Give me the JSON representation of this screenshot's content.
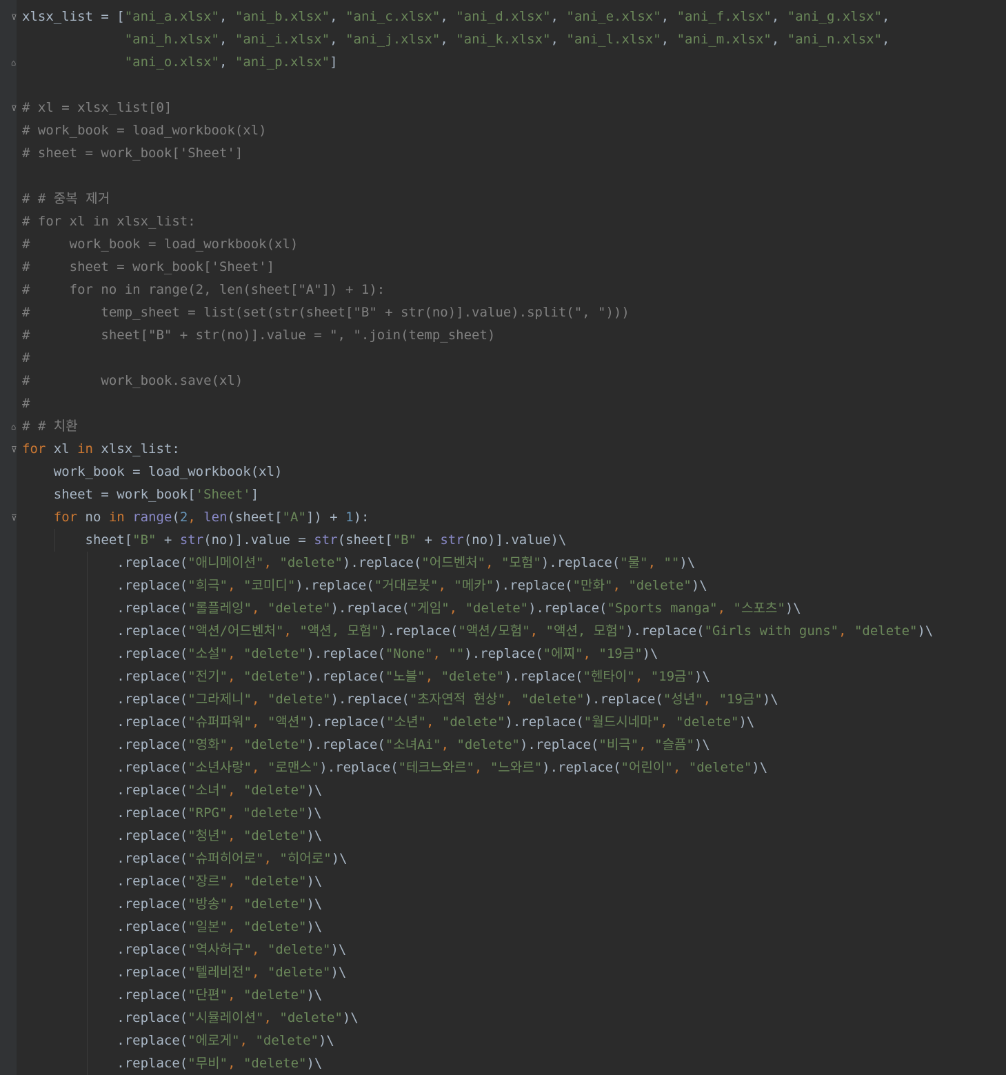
{
  "editor": {
    "theme": "darcula",
    "colors": {
      "background": "#2b2b2b",
      "gutter": "#313335",
      "text": "#a9b7c6",
      "string": "#6a8759",
      "keyword": "#cc7832",
      "number": "#6897bb",
      "builtin": "#8888c6",
      "comment": "#808080"
    },
    "lines": [
      [
        [
          "t",
          "xlsx_list = ["
        ],
        [
          "s",
          "\"ani_a.xlsx\""
        ],
        [
          "t",
          ", "
        ],
        [
          "s",
          "\"ani_b.xlsx\""
        ],
        [
          "t",
          ", "
        ],
        [
          "s",
          "\"ani_c.xlsx\""
        ],
        [
          "t",
          ", "
        ],
        [
          "s",
          "\"ani_d.xlsx\""
        ],
        [
          "t",
          ", "
        ],
        [
          "s",
          "\"ani_e.xlsx\""
        ],
        [
          "t",
          ", "
        ],
        [
          "s",
          "\"ani_f.xlsx\""
        ],
        [
          "t",
          ", "
        ],
        [
          "s",
          "\"ani_g.xlsx\""
        ],
        [
          "t",
          ","
        ]
      ],
      [
        [
          "t",
          "             "
        ],
        [
          "s",
          "\"ani_h.xlsx\""
        ],
        [
          "t",
          ", "
        ],
        [
          "s",
          "\"ani_i.xlsx\""
        ],
        [
          "t",
          ", "
        ],
        [
          "s",
          "\"ani_j.xlsx\""
        ],
        [
          "t",
          ", "
        ],
        [
          "s",
          "\"ani_k.xlsx\""
        ],
        [
          "t",
          ", "
        ],
        [
          "s",
          "\"ani_l.xlsx\""
        ],
        [
          "t",
          ", "
        ],
        [
          "s",
          "\"ani_m.xlsx\""
        ],
        [
          "t",
          ", "
        ],
        [
          "s",
          "\"ani_n.xlsx\""
        ],
        [
          "t",
          ","
        ]
      ],
      [
        [
          "t",
          "             "
        ],
        [
          "s",
          "\"ani_o.xlsx\""
        ],
        [
          "t",
          ", "
        ],
        [
          "s",
          "\"ani_p.xlsx\""
        ],
        [
          "t",
          "]"
        ]
      ],
      [],
      [
        [
          "c",
          "# xl = xlsx_list[0]"
        ]
      ],
      [
        [
          "c",
          "# work_book = load_workbook(xl)"
        ]
      ],
      [
        [
          "c",
          "# sheet = work_book['Sheet']"
        ]
      ],
      [],
      [
        [
          "c",
          "# # 중복 제거"
        ]
      ],
      [
        [
          "c",
          "# for xl in xlsx_list:"
        ]
      ],
      [
        [
          "c",
          "#     work_book = load_workbook(xl)"
        ]
      ],
      [
        [
          "c",
          "#     sheet = work_book['Sheet']"
        ]
      ],
      [
        [
          "c",
          "#     for no in range(2, len(sheet[\"A\"]) + 1):"
        ]
      ],
      [
        [
          "c",
          "#         temp_sheet = list(set(str(sheet[\"B\" + str(no)].value).split(\", \")))"
        ]
      ],
      [
        [
          "c",
          "#         sheet[\"B\" + str(no)].value = \", \".join(temp_sheet)"
        ]
      ],
      [
        [
          "c",
          "#"
        ]
      ],
      [
        [
          "c",
          "#         work_book.save(xl)"
        ]
      ],
      [
        [
          "c",
          "#"
        ]
      ],
      [
        [
          "c",
          "# # 치환"
        ]
      ],
      [
        [
          "k",
          "for"
        ],
        [
          "t",
          " xl "
        ],
        [
          "k",
          "in"
        ],
        [
          "t",
          " xlsx_list:"
        ]
      ],
      [
        [
          "t",
          "    work_book = load_workbook(xl)"
        ]
      ],
      [
        [
          "t",
          "    sheet = work_book["
        ],
        [
          "s",
          "'Sheet'"
        ],
        [
          "t",
          "]"
        ]
      ],
      [
        [
          "t",
          "    "
        ],
        [
          "k",
          "for"
        ],
        [
          "t",
          " no "
        ],
        [
          "k",
          "in"
        ],
        [
          "t",
          " "
        ],
        [
          "b",
          "range"
        ],
        [
          "t",
          "("
        ],
        [
          "n",
          "2"
        ],
        [
          "k",
          ", "
        ],
        [
          "b",
          "len"
        ],
        [
          "t",
          "(sheet["
        ],
        [
          "s",
          "\"A\""
        ],
        [
          "t",
          "]) + "
        ],
        [
          "n",
          "1"
        ],
        [
          "t",
          "):"
        ]
      ],
      [
        [
          "t",
          "        sheet["
        ],
        [
          "s",
          "\"B\""
        ],
        [
          "t",
          " + "
        ],
        [
          "b",
          "str"
        ],
        [
          "t",
          "(no)].value = "
        ],
        [
          "b",
          "str"
        ],
        [
          "t",
          "(sheet["
        ],
        [
          "s",
          "\"B\""
        ],
        [
          "t",
          " + "
        ],
        [
          "b",
          "str"
        ],
        [
          "t",
          "(no)].value)\\"
        ]
      ],
      [
        [
          "t",
          "            .replace("
        ],
        [
          "s",
          "\"애니메이션\""
        ],
        [
          "k",
          ", "
        ],
        [
          "s",
          "\"delete\""
        ],
        [
          "t",
          ").replace("
        ],
        [
          "s",
          "\"어드벤처\""
        ],
        [
          "k",
          ", "
        ],
        [
          "s",
          "\"모험\""
        ],
        [
          "t",
          ").replace("
        ],
        [
          "s",
          "\"물\""
        ],
        [
          "k",
          ", "
        ],
        [
          "s",
          "\"\""
        ],
        [
          "t",
          ")\\"
        ]
      ],
      [
        [
          "t",
          "            .replace("
        ],
        [
          "s",
          "\"희극\""
        ],
        [
          "k",
          ", "
        ],
        [
          "s",
          "\"코미디\""
        ],
        [
          "t",
          ").replace("
        ],
        [
          "s",
          "\"거대로봇\""
        ],
        [
          "k",
          ", "
        ],
        [
          "s",
          "\"메카\""
        ],
        [
          "t",
          ").replace("
        ],
        [
          "s",
          "\"만화\""
        ],
        [
          "k",
          ", "
        ],
        [
          "s",
          "\"delete\""
        ],
        [
          "t",
          ")\\"
        ]
      ],
      [
        [
          "t",
          "            .replace("
        ],
        [
          "s",
          "\"롤플레잉\""
        ],
        [
          "k",
          ", "
        ],
        [
          "s",
          "\"delete\""
        ],
        [
          "t",
          ").replace("
        ],
        [
          "s",
          "\"게임\""
        ],
        [
          "k",
          ", "
        ],
        [
          "s",
          "\"delete\""
        ],
        [
          "t",
          ").replace("
        ],
        [
          "s",
          "\"Sports manga\""
        ],
        [
          "k",
          ", "
        ],
        [
          "s",
          "\"스포츠\""
        ],
        [
          "t",
          ")\\"
        ]
      ],
      [
        [
          "t",
          "            .replace("
        ],
        [
          "s",
          "\"액션/어드벤처\""
        ],
        [
          "k",
          ", "
        ],
        [
          "s",
          "\"액션, 모험\""
        ],
        [
          "t",
          ").replace("
        ],
        [
          "s",
          "\"액션/모험\""
        ],
        [
          "k",
          ", "
        ],
        [
          "s",
          "\"액션, 모험\""
        ],
        [
          "t",
          ").replace("
        ],
        [
          "s",
          "\"Girls with guns\""
        ],
        [
          "k",
          ", "
        ],
        [
          "s",
          "\"delete\""
        ],
        [
          "t",
          ")\\"
        ]
      ],
      [
        [
          "t",
          "            .replace("
        ],
        [
          "s",
          "\"소설\""
        ],
        [
          "k",
          ", "
        ],
        [
          "s",
          "\"delete\""
        ],
        [
          "t",
          ").replace("
        ],
        [
          "s",
          "\"None\""
        ],
        [
          "k",
          ", "
        ],
        [
          "s",
          "\"\""
        ],
        [
          "t",
          ").replace("
        ],
        [
          "s",
          "\"에찌\""
        ],
        [
          "k",
          ", "
        ],
        [
          "s",
          "\"19금\""
        ],
        [
          "t",
          ")\\"
        ]
      ],
      [
        [
          "t",
          "            .replace("
        ],
        [
          "s",
          "\"전기\""
        ],
        [
          "k",
          ", "
        ],
        [
          "s",
          "\"delete\""
        ],
        [
          "t",
          ").replace("
        ],
        [
          "s",
          "\"노블\""
        ],
        [
          "k",
          ", "
        ],
        [
          "s",
          "\"delete\""
        ],
        [
          "t",
          ").replace("
        ],
        [
          "s",
          "\"헨타이\""
        ],
        [
          "k",
          ", "
        ],
        [
          "s",
          "\"19금\""
        ],
        [
          "t",
          ")\\"
        ]
      ],
      [
        [
          "t",
          "            .replace("
        ],
        [
          "s",
          "\"그라제니\""
        ],
        [
          "k",
          ", "
        ],
        [
          "s",
          "\"delete\""
        ],
        [
          "t",
          ").replace("
        ],
        [
          "s",
          "\"초자연적 현상\""
        ],
        [
          "k",
          ", "
        ],
        [
          "s",
          "\"delete\""
        ],
        [
          "t",
          ").replace("
        ],
        [
          "s",
          "\"성년\""
        ],
        [
          "k",
          ", "
        ],
        [
          "s",
          "\"19금\""
        ],
        [
          "t",
          ")\\"
        ]
      ],
      [
        [
          "t",
          "            .replace("
        ],
        [
          "s",
          "\"슈퍼파워\""
        ],
        [
          "k",
          ", "
        ],
        [
          "s",
          "\"액션\""
        ],
        [
          "t",
          ").replace("
        ],
        [
          "s",
          "\"소년\""
        ],
        [
          "k",
          ", "
        ],
        [
          "s",
          "\"delete\""
        ],
        [
          "t",
          ").replace("
        ],
        [
          "s",
          "\"월드시네마\""
        ],
        [
          "k",
          ", "
        ],
        [
          "s",
          "\"delete\""
        ],
        [
          "t",
          ")\\"
        ]
      ],
      [
        [
          "t",
          "            .replace("
        ],
        [
          "s",
          "\"영화\""
        ],
        [
          "k",
          ", "
        ],
        [
          "s",
          "\"delete\""
        ],
        [
          "t",
          ").replace("
        ],
        [
          "s",
          "\"소녀Ai\""
        ],
        [
          "k",
          ", "
        ],
        [
          "s",
          "\"delete\""
        ],
        [
          "t",
          ").replace("
        ],
        [
          "s",
          "\"비극\""
        ],
        [
          "k",
          ", "
        ],
        [
          "s",
          "\"슬픔\""
        ],
        [
          "t",
          ")\\"
        ]
      ],
      [
        [
          "t",
          "            .replace("
        ],
        [
          "s",
          "\"소년사랑\""
        ],
        [
          "k",
          ", "
        ],
        [
          "s",
          "\"로맨스\""
        ],
        [
          "t",
          ").replace("
        ],
        [
          "s",
          "\"테크느와르\""
        ],
        [
          "k",
          ", "
        ],
        [
          "s",
          "\"느와르\""
        ],
        [
          "t",
          ").replace("
        ],
        [
          "s",
          "\"어린이\""
        ],
        [
          "k",
          ", "
        ],
        [
          "s",
          "\"delete\""
        ],
        [
          "t",
          ")\\"
        ]
      ],
      [
        [
          "t",
          "            .replace("
        ],
        [
          "s",
          "\"소녀\""
        ],
        [
          "k",
          ", "
        ],
        [
          "s",
          "\"delete\""
        ],
        [
          "t",
          ")\\"
        ]
      ],
      [
        [
          "t",
          "            .replace("
        ],
        [
          "s",
          "\"RPG\""
        ],
        [
          "k",
          ", "
        ],
        [
          "s",
          "\"delete\""
        ],
        [
          "t",
          ")\\"
        ]
      ],
      [
        [
          "t",
          "            .replace("
        ],
        [
          "s",
          "\"청년\""
        ],
        [
          "k",
          ", "
        ],
        [
          "s",
          "\"delete\""
        ],
        [
          "t",
          ")\\"
        ]
      ],
      [
        [
          "t",
          "            .replace("
        ],
        [
          "s",
          "\"슈퍼히어로\""
        ],
        [
          "k",
          ", "
        ],
        [
          "s",
          "\"히어로\""
        ],
        [
          "t",
          ")\\"
        ]
      ],
      [
        [
          "t",
          "            .replace("
        ],
        [
          "s",
          "\"장르\""
        ],
        [
          "k",
          ", "
        ],
        [
          "s",
          "\"delete\""
        ],
        [
          "t",
          ")\\"
        ]
      ],
      [
        [
          "t",
          "            .replace("
        ],
        [
          "s",
          "\"방송\""
        ],
        [
          "k",
          ", "
        ],
        [
          "s",
          "\"delete\""
        ],
        [
          "t",
          ")\\"
        ]
      ],
      [
        [
          "t",
          "            .replace("
        ],
        [
          "s",
          "\"일본\""
        ],
        [
          "k",
          ", "
        ],
        [
          "s",
          "\"delete\""
        ],
        [
          "t",
          ")\\"
        ]
      ],
      [
        [
          "t",
          "            .replace("
        ],
        [
          "s",
          "\"역사허구\""
        ],
        [
          "k",
          ", "
        ],
        [
          "s",
          "\"delete\""
        ],
        [
          "t",
          ")\\"
        ]
      ],
      [
        [
          "t",
          "            .replace("
        ],
        [
          "s",
          "\"텔레비전\""
        ],
        [
          "k",
          ", "
        ],
        [
          "s",
          "\"delete\""
        ],
        [
          "t",
          ")\\"
        ]
      ],
      [
        [
          "t",
          "            .replace("
        ],
        [
          "s",
          "\"단편\""
        ],
        [
          "k",
          ", "
        ],
        [
          "s",
          "\"delete\""
        ],
        [
          "t",
          ")\\"
        ]
      ],
      [
        [
          "t",
          "            .replace("
        ],
        [
          "s",
          "\"시뮬레이션\""
        ],
        [
          "k",
          ", "
        ],
        [
          "s",
          "\"delete\""
        ],
        [
          "t",
          ")\\"
        ]
      ],
      [
        [
          "t",
          "            .replace("
        ],
        [
          "s",
          "\"에로게\""
        ],
        [
          "k",
          ", "
        ],
        [
          "s",
          "\"delete\""
        ],
        [
          "t",
          ")\\"
        ]
      ],
      [
        [
          "t",
          "            .replace("
        ],
        [
          "s",
          "\"무비\""
        ],
        [
          "k",
          ", "
        ],
        [
          "s",
          "\"delete\""
        ],
        [
          "t",
          ")\\"
        ]
      ]
    ],
    "fold_markers": [
      {
        "line": 0,
        "icon": "fold-open-icon",
        "glyph": "⊽"
      },
      {
        "line": 2,
        "icon": "fold-end-icon",
        "glyph": "⌂"
      },
      {
        "line": 4,
        "icon": "fold-open-icon",
        "glyph": "⊽"
      },
      {
        "line": 18,
        "icon": "fold-end-icon",
        "glyph": "⌂"
      },
      {
        "line": 19,
        "icon": "fold-open-icon",
        "glyph": "⊽"
      },
      {
        "line": 22,
        "icon": "fold-open-icon",
        "glyph": "⊽"
      }
    ]
  }
}
